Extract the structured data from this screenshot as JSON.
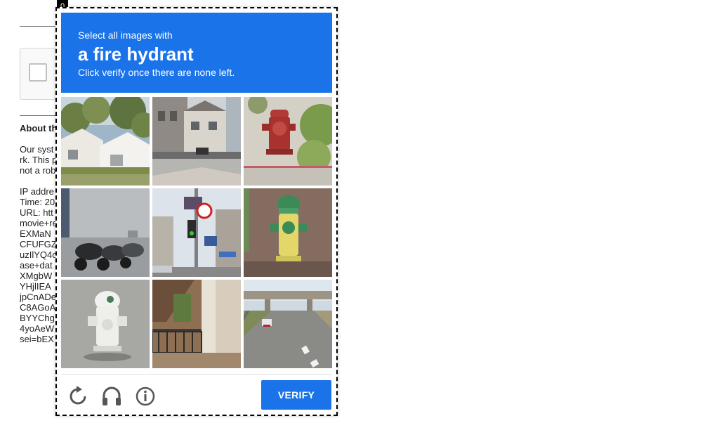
{
  "background": {
    "about_heading": "About th",
    "lines": [
      "Our syst",
      "rk. This p",
      "not a rob",
      "",
      "IP addre",
      "Time: 20",
      "URL: htt",
      "movie+re",
      "EXMaN",
      "CFUFGZ",
      "uzIlYQ4c",
      "ase+dat",
      "XMgbW",
      "YHjlIEA",
      "jpCnADe",
      "C8AGoA",
      "BYYChg",
      "4yoAeW",
      "sei=bEX"
    ]
  },
  "challenge": {
    "counter": "0",
    "instruction_top": "Select all images with",
    "target": "a fire hydrant",
    "instruction_bottom": "Click verify once there are none left.",
    "verify_label": "VERIFY",
    "tiles": [
      {
        "id": 1,
        "scene": "white houses with trees"
      },
      {
        "id": 2,
        "scene": "street with buildings"
      },
      {
        "id": 3,
        "scene": "red fire hydrant by bushes"
      },
      {
        "id": 4,
        "scene": "motorcycles parked by wall"
      },
      {
        "id": 5,
        "scene": "traffic lights and street signs"
      },
      {
        "id": 6,
        "scene": "green and yellow fire hydrant"
      },
      {
        "id": 7,
        "scene": "white fire hydrant"
      },
      {
        "id": 8,
        "scene": "building with balconies"
      },
      {
        "id": 9,
        "scene": "highway with overpass"
      }
    ],
    "icons": {
      "reload": "reload-icon",
      "audio": "headphones-icon",
      "info": "info-icon"
    },
    "colors": {
      "accent": "#1a73e8"
    }
  }
}
